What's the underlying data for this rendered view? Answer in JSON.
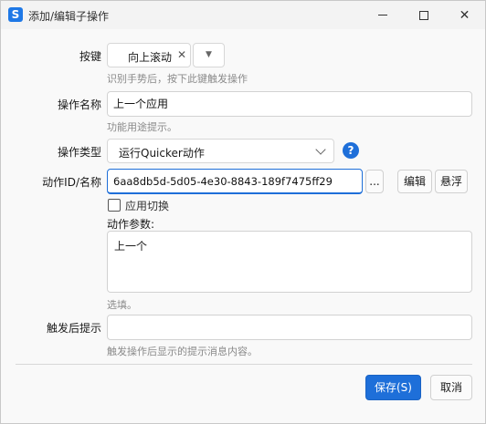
{
  "window": {
    "title": "添加/编辑子操作",
    "app_icon": "S"
  },
  "hotkey": {
    "label": "按键",
    "value": "向上滚动",
    "hint": "识别手势后，按下此键触发操作"
  },
  "action_name": {
    "label": "操作名称",
    "value": "上一个应用",
    "hint": "功能用途提示。"
  },
  "action_type": {
    "label": "操作类型",
    "value": "运行Quicker动作"
  },
  "action_id": {
    "label": "动作ID/名称",
    "value": "6aa8db5d-5d05-4e30-8843-189f7475ff29",
    "browse_label": "...",
    "edit_label": "编辑",
    "float_label": "悬浮"
  },
  "app_switch": {
    "label": "应用切换",
    "checked": false
  },
  "params": {
    "label": "动作参数:",
    "value": "上一个",
    "hint": "选填。"
  },
  "post_tip": {
    "label": "触发后提示",
    "value": "",
    "hint": "触发操作后显示的提示消息内容。"
  },
  "footer": {
    "save_label": "保存(S)",
    "cancel_label": "取消"
  },
  "colors": {
    "accent": "#1e6fd9"
  }
}
